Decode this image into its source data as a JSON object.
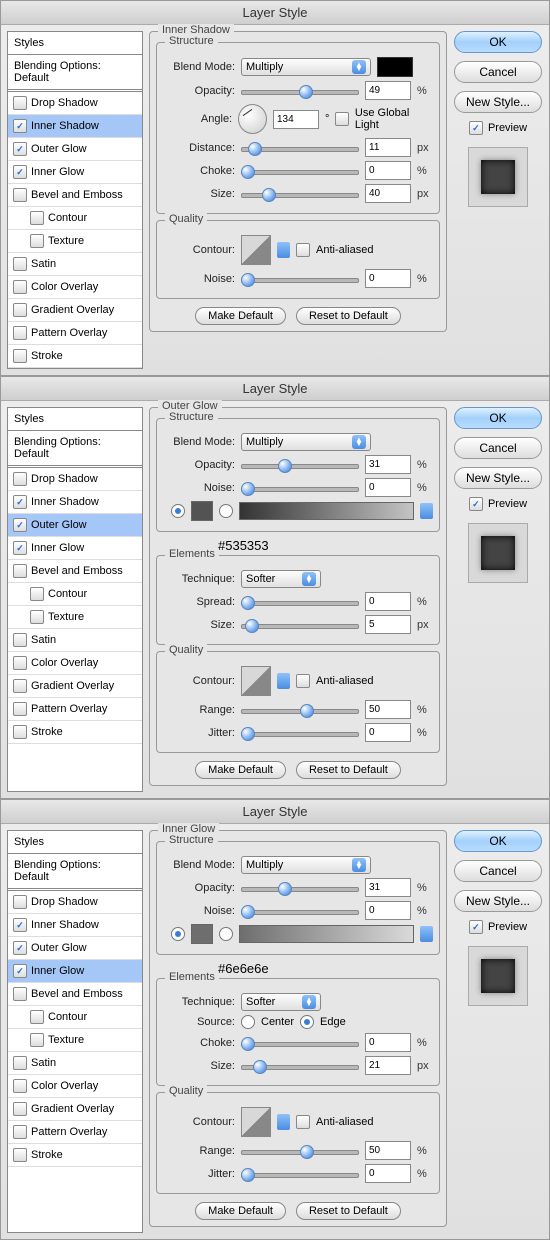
{
  "dialogs": [
    {
      "title": "Layer Style",
      "styleSel": "Inner Shadow",
      "sidebar": {
        "header": "Styles",
        "sub": "Blending Options: Default",
        "items": [
          {
            "label": "Drop Shadow",
            "on": false
          },
          {
            "label": "Inner Shadow",
            "on": true,
            "sel": true
          },
          {
            "label": "Outer Glow",
            "on": true
          },
          {
            "label": "Inner Glow",
            "on": true
          },
          {
            "label": "Bevel and Emboss",
            "on": false
          },
          {
            "label": "Contour",
            "on": false,
            "indent": true
          },
          {
            "label": "Texture",
            "on": false,
            "indent": true
          },
          {
            "label": "Satin",
            "on": false
          },
          {
            "label": "Color Overlay",
            "on": false
          },
          {
            "label": "Gradient Overlay",
            "on": false
          },
          {
            "label": "Pattern Overlay",
            "on": false
          },
          {
            "label": "Stroke",
            "on": false
          }
        ]
      },
      "main": {
        "heading": "Inner Shadow",
        "structure": {
          "legend": "Structure",
          "blend_lbl": "Blend Mode:",
          "blend_val": "Multiply",
          "swatch": "#000000",
          "opacity": {
            "lbl": "Opacity:",
            "val": "49",
            "pos": 49,
            "unit": "%"
          },
          "angle": {
            "lbl": "Angle:",
            "val": "134",
            "deg": "°",
            "ugl": "Use Global Light"
          },
          "distance": {
            "lbl": "Distance:",
            "val": "11",
            "pos": 6,
            "unit": "px"
          },
          "choke": {
            "lbl": "Choke:",
            "val": "0",
            "pos": 0,
            "unit": "%"
          },
          "size": {
            "lbl": "Size:",
            "val": "40",
            "pos": 18,
            "unit": "px"
          }
        },
        "quality": {
          "legend": "Quality",
          "contour_lbl": "Contour:",
          "aa": "Anti-aliased",
          "noise": {
            "lbl": "Noise:",
            "val": "0",
            "pos": 0,
            "unit": "%"
          }
        },
        "btns": {
          "make": "Make Default",
          "reset": "Reset to Default"
        }
      },
      "right": {
        "ok": "OK",
        "cancel": "Cancel",
        "new": "New Style...",
        "preview": "Preview"
      }
    },
    {
      "title": "Layer Style",
      "styleSel": "Outer Glow",
      "colorNote": "#535353",
      "sidebar": {
        "header": "Styles",
        "sub": "Blending Options: Default",
        "items": [
          {
            "label": "Drop Shadow",
            "on": false
          },
          {
            "label": "Inner Shadow",
            "on": true
          },
          {
            "label": "Outer Glow",
            "on": true,
            "sel": true
          },
          {
            "label": "Inner Glow",
            "on": true
          },
          {
            "label": "Bevel and Emboss",
            "on": false
          },
          {
            "label": "Contour",
            "on": false,
            "indent": true
          },
          {
            "label": "Texture",
            "on": false,
            "indent": true
          },
          {
            "label": "Satin",
            "on": false
          },
          {
            "label": "Color Overlay",
            "on": false
          },
          {
            "label": "Gradient Overlay",
            "on": false
          },
          {
            "label": "Pattern Overlay",
            "on": false
          },
          {
            "label": "Stroke",
            "on": false
          }
        ]
      },
      "main": {
        "heading": "Outer Glow",
        "structure": {
          "legend": "Structure",
          "blend_lbl": "Blend Mode:",
          "blend_val": "Multiply",
          "opacity": {
            "lbl": "Opacity:",
            "val": "31",
            "pos": 31,
            "unit": "%"
          },
          "noise": {
            "lbl": "Noise:",
            "val": "0",
            "pos": 0,
            "unit": "%"
          },
          "swatches": {
            "c1": "#535353"
          }
        },
        "elements": {
          "legend": "Elements",
          "tech_lbl": "Technique:",
          "tech_val": "Softer",
          "spread": {
            "lbl": "Spread:",
            "val": "0",
            "pos": 0,
            "unit": "%"
          },
          "size": {
            "lbl": "Size:",
            "val": "5",
            "pos": 3,
            "unit": "px"
          }
        },
        "quality": {
          "legend": "Quality",
          "contour_lbl": "Contour:",
          "aa": "Anti-aliased",
          "range": {
            "lbl": "Range:",
            "val": "50",
            "pos": 50,
            "unit": "%"
          },
          "jitter": {
            "lbl": "Jitter:",
            "val": "0",
            "pos": 0,
            "unit": "%"
          }
        },
        "btns": {
          "make": "Make Default",
          "reset": "Reset to Default"
        }
      },
      "right": {
        "ok": "OK",
        "cancel": "Cancel",
        "new": "New Style...",
        "preview": "Preview"
      }
    },
    {
      "title": "Layer Style",
      "styleSel": "Inner Glow",
      "colorNote": "#6e6e6e",
      "sidebar": {
        "header": "Styles",
        "sub": "Blending Options: Default",
        "items": [
          {
            "label": "Drop Shadow",
            "on": false
          },
          {
            "label": "Inner Shadow",
            "on": true
          },
          {
            "label": "Outer Glow",
            "on": true
          },
          {
            "label": "Inner Glow",
            "on": true,
            "sel": true
          },
          {
            "label": "Bevel and Emboss",
            "on": false
          },
          {
            "label": "Contour",
            "on": false,
            "indent": true
          },
          {
            "label": "Texture",
            "on": false,
            "indent": true
          },
          {
            "label": "Satin",
            "on": false
          },
          {
            "label": "Color Overlay",
            "on": false
          },
          {
            "label": "Gradient Overlay",
            "on": false
          },
          {
            "label": "Pattern Overlay",
            "on": false
          },
          {
            "label": "Stroke",
            "on": false
          }
        ]
      },
      "main": {
        "heading": "Inner Glow",
        "structure": {
          "legend": "Structure",
          "blend_lbl": "Blend Mode:",
          "blend_val": "Multiply",
          "opacity": {
            "lbl": "Opacity:",
            "val": "31",
            "pos": 31,
            "unit": "%"
          },
          "noise": {
            "lbl": "Noise:",
            "val": "0",
            "pos": 0,
            "unit": "%"
          },
          "swatches": {
            "c1": "#6e6e6e"
          }
        },
        "elements": {
          "legend": "Elements",
          "tech_lbl": "Technique:",
          "tech_val": "Softer",
          "source_lbl": "Source:",
          "source_center": "Center",
          "source_edge": "Edge",
          "choke": {
            "lbl": "Choke:",
            "val": "0",
            "pos": 0,
            "unit": "%"
          },
          "size": {
            "lbl": "Size:",
            "val": "21",
            "pos": 10,
            "unit": "px"
          }
        },
        "quality": {
          "legend": "Quality",
          "contour_lbl": "Contour:",
          "aa": "Anti-aliased",
          "range": {
            "lbl": "Range:",
            "val": "50",
            "pos": 50,
            "unit": "%"
          },
          "jitter": {
            "lbl": "Jitter:",
            "val": "0",
            "pos": 0,
            "unit": "%"
          }
        },
        "btns": {
          "make": "Make Default",
          "reset": "Reset to Default"
        }
      },
      "right": {
        "ok": "OK",
        "cancel": "Cancel",
        "new": "New Style...",
        "preview": "Preview"
      }
    }
  ]
}
